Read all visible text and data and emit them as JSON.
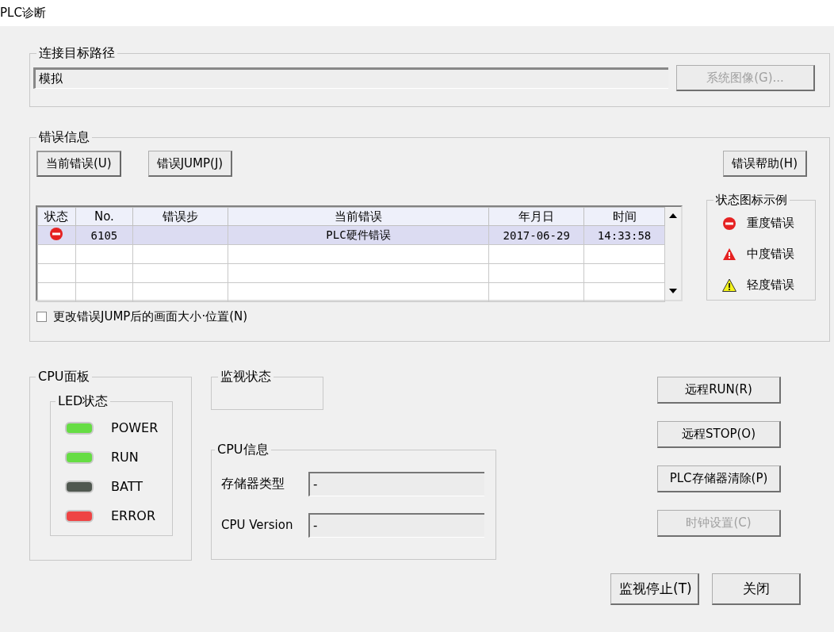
{
  "window": {
    "title": "PLC诊断"
  },
  "connection": {
    "title": "连接目标路径",
    "path": "模拟",
    "buttons": [
      {
        "label": "系统图像(G)...",
        "disabled": true
      }
    ]
  },
  "error_info": {
    "title": "错误信息",
    "buttons": [
      {
        "label": "当前错误(U)",
        "default": true
      },
      {
        "label": "错误JUMP(J)",
        "default": false
      }
    ],
    "help_button": {
      "label": "错误帮助(H)",
      "default": false
    },
    "table": {
      "columns": [
        "状态",
        "No.",
        "错误步",
        "当前错误",
        "年月日",
        "时间"
      ],
      "rows": [
        {
          "kind": "major",
          "no": "6105",
          "error": "PLC硬件错误",
          "date": "2017-06-29",
          "time": "14:33:58",
          "selected": true
        }
      ]
    },
    "legend": {
      "title": "状态图标示例",
      "items": [
        {
          "kind": "major",
          "label": "重度错误"
        },
        {
          "kind": "moderate",
          "label": "中度错误"
        },
        {
          "kind": "minor",
          "label": "轻度错误"
        }
      ]
    },
    "checkbox": {
      "label": "更改错误JUMP后的画面大小·位置(N)",
      "checked": false
    }
  },
  "cpu_panel": {
    "title": "CPU面板",
    "led_group": {
      "title": "LED状态",
      "leds": [
        {
          "label": "POWER",
          "color": "#66dd44"
        },
        {
          "label": "RUN",
          "color": "#66dd44"
        },
        {
          "label": "BATT",
          "color": "#505850"
        },
        {
          "label": "ERROR",
          "color": "#ee4444"
        }
      ]
    }
  },
  "monitor_status": {
    "title": "监视状态"
  },
  "cpu_info": {
    "title": "CPU信息",
    "fields": [
      {
        "label": "存储器类型",
        "value": "-"
      },
      {
        "label": "CPU Version",
        "value": "-"
      }
    ]
  },
  "side_buttons": [
    {
      "label": "远程RUN(R)",
      "disabled": false
    },
    {
      "label": "远程STOP(O)",
      "disabled": false
    },
    {
      "label": "PLC存储器清除(P)",
      "disabled": false
    },
    {
      "label": "时钟设置(C)",
      "disabled": true
    }
  ],
  "footer_buttons": [
    {
      "label": "监视停止(T)",
      "disabled": false
    },
    {
      "label": "关闭",
      "disabled": false
    }
  ]
}
